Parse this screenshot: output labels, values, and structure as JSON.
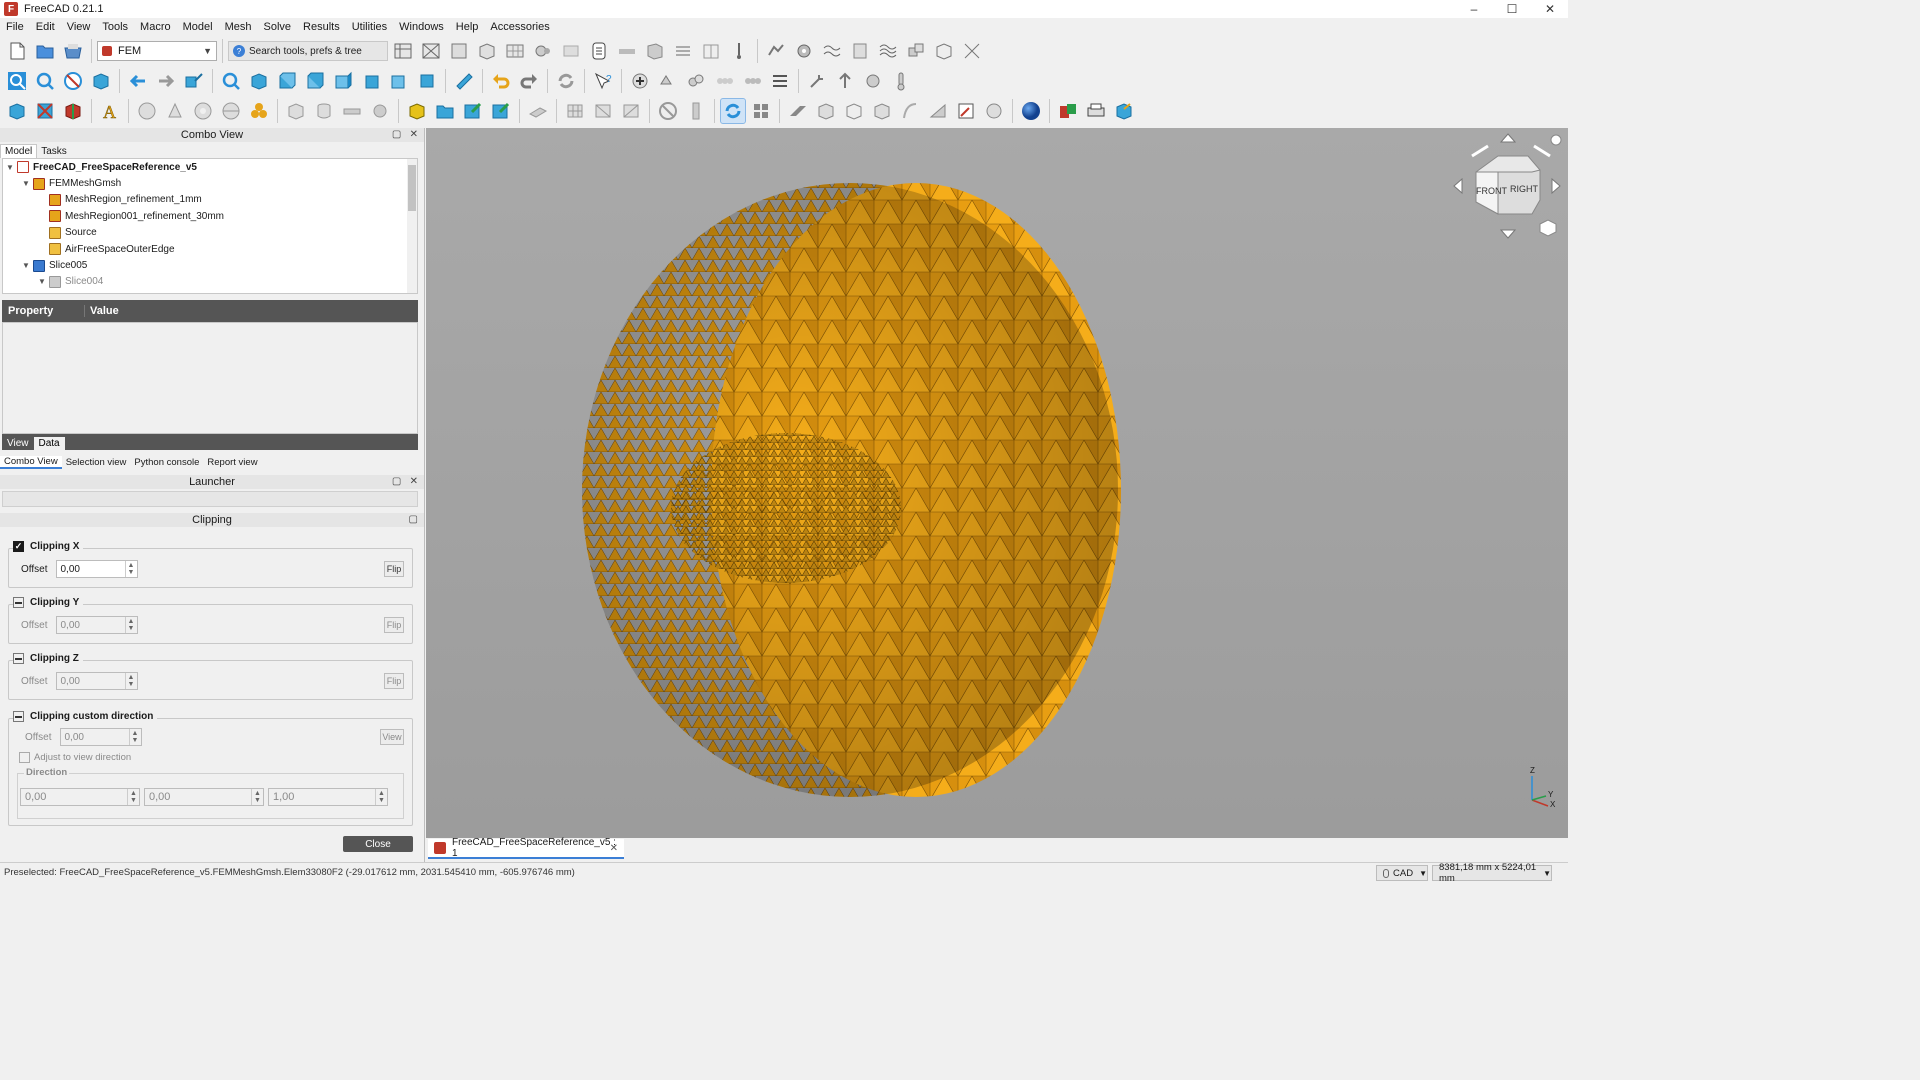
{
  "window": {
    "title": "FreeCAD 0.21.1"
  },
  "menu": [
    "File",
    "Edit",
    "View",
    "Tools",
    "Macro",
    "Model",
    "Mesh",
    "Solve",
    "Results",
    "Utilities",
    "Windows",
    "Help",
    "Accessories"
  ],
  "toolbar": {
    "workbench": "FEM",
    "search_placeholder": "Search tools, prefs & tree"
  },
  "combo_view": {
    "title": "Combo View",
    "tabs": [
      "Model",
      "Tasks"
    ],
    "tree": [
      {
        "label": "FreeCAD_FreeSpaceReference_v5",
        "bold": true
      },
      {
        "label": "FEMMeshGmsh"
      },
      {
        "label": "MeshRegion_refinement_1mm"
      },
      {
        "label": "MeshRegion001_refinement_30mm"
      },
      {
        "label": "Source"
      },
      {
        "label": "AirFreeSpaceOuterEdge"
      },
      {
        "label": "Slice005"
      },
      {
        "label": "Slice004"
      }
    ],
    "property_header": {
      "property": "Property",
      "value": "Value"
    },
    "view_data_tabs": [
      "View",
      "Data"
    ],
    "bottom_tabs": [
      "Combo View",
      "Selection view",
      "Python console",
      "Report view"
    ]
  },
  "launcher": {
    "title": "Launcher"
  },
  "clipping": {
    "title": "Clipping",
    "groups": [
      {
        "label": "Clipping X",
        "offset_label": "Offset",
        "offset": "0,00",
        "flip": "Flip"
      },
      {
        "label": "Clipping Y",
        "offset_label": "Offset",
        "offset": "0,00",
        "flip": "Flip"
      },
      {
        "label": "Clipping Z",
        "offset_label": "Offset",
        "offset": "0,00",
        "flip": "Flip"
      }
    ],
    "custom": {
      "label": "Clipping custom direction",
      "offset_label": "Offset",
      "offset": "0,00",
      "view_button": "View",
      "adjust_label": "Adjust to view direction",
      "direction_label": "Direction",
      "direction": [
        "0,00",
        "0,00",
        "1,00"
      ]
    },
    "close": "Close"
  },
  "navcube": {
    "front": "FRONT",
    "right": "RIGHT"
  },
  "axes": {
    "z": "Z",
    "y": "Y",
    "x": "X"
  },
  "doc_tab": "FreeCAD_FreeSpaceReference_v5 : 1",
  "status": {
    "preselected": "Preselected: FreeCAD_FreeSpaceReference_v5.FEMMeshGmsh.Elem33080F2 (-29.017612 mm, 2031.545410 mm, -605.976746 mm)",
    "nav_style": "CAD",
    "dimensions": "8381,18 mm x 5224,01 mm"
  },
  "colors": {
    "mesh": "#f2a516",
    "mesh_dark": "#b9770b",
    "selection": "#3b7fd6",
    "viewport": "#a4a4a4"
  }
}
